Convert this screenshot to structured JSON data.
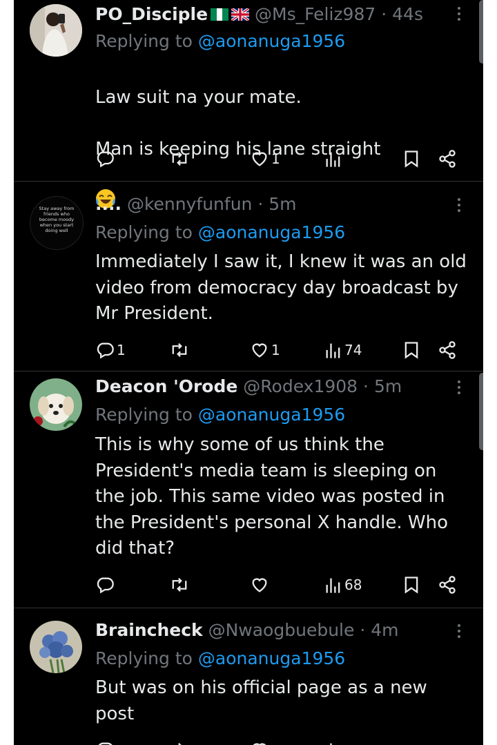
{
  "tweets": [
    {
      "name": "PO_Disciple",
      "flags": [
        "nigeria-flag",
        "uk-flag"
      ],
      "handle": "@Ms_Feliz987",
      "sep": "·",
      "time": "44s",
      "replying_prefix": "Replying to",
      "replying_to": "@aonanuga1956",
      "text": "Law suit na your mate.\n\nMan is keeping his lane straight",
      "emoji": "😂",
      "replies": "",
      "reposts": "",
      "likes": "1",
      "views": ""
    },
    {
      "name": "....",
      "handle": "@kennyfunfun",
      "sep": "·",
      "time": "5m",
      "avatar_text": "Stay away from friends who become moody when you start doing well",
      "replying_prefix": "Replying to",
      "replying_to": "@aonanuga1956",
      "text": "Immediately I saw it, I knew it was an old video from democracy day broadcast by Mr President.",
      "replies": "1",
      "reposts": "",
      "likes": "1",
      "views": "74"
    },
    {
      "name": "Deacon 'Orode",
      "handle": "@Rodex1908",
      "sep": "·",
      "time": "5m",
      "replying_prefix": "Replying to",
      "replying_to": "@aonanuga1956",
      "text": "This is why some of us think the President's media team is sleeping on the job. This same video was posted in the President's personal X handle. Who did that?",
      "replies": "",
      "reposts": "",
      "likes": "",
      "views": "68"
    },
    {
      "name": "Braincheck",
      "handle": "@Nwaogbuebule",
      "sep": "·",
      "time": "4m",
      "replying_prefix": "Replying to",
      "replying_to": "@aonanuga1956",
      "text": "But was on his official page as a new post",
      "replies": "",
      "reposts": "",
      "likes": "",
      "views": ""
    }
  ],
  "icons": [
    "reply-icon",
    "repost-icon",
    "like-icon",
    "views-icon",
    "bookmark-icon",
    "share-icon",
    "more-icon"
  ],
  "colors": {
    "background": "#000000",
    "primary_text": "#e7e9ea",
    "secondary_text": "#71767b",
    "link": "#1d9bf0",
    "divider": "#2f3336"
  }
}
